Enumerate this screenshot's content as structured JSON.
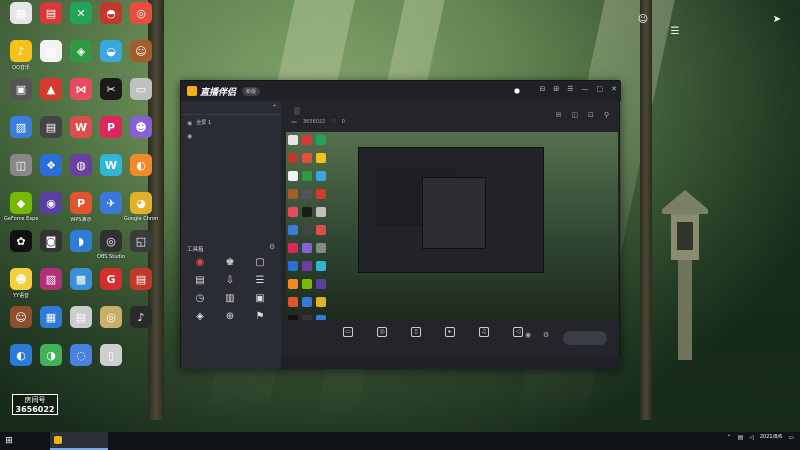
{
  "desktop": {
    "icons": [
      {
        "label": "",
        "color": "#e6e6e6",
        "glyph": "▦"
      },
      {
        "label": "",
        "color": "#d9383a",
        "glyph": "▤"
      },
      {
        "label": "",
        "color": "#22a35a",
        "glyph": "✕"
      },
      {
        "label": "",
        "color": "#c0392b",
        "glyph": "◓"
      },
      {
        "label": "",
        "color": "#e74c3c",
        "glyph": "◎"
      },
      {
        "label": "QQ音乐",
        "color": "#f4c21b",
        "glyph": "♪"
      },
      {
        "label": "",
        "color": "#f3f3f3",
        "glyph": "▥"
      },
      {
        "label": "",
        "color": "#2e9b44",
        "glyph": "◈"
      },
      {
        "label": "",
        "color": "#3aa7e0",
        "glyph": "◒"
      },
      {
        "label": "",
        "color": "#a35d2b",
        "glyph": "☺"
      },
      {
        "label": "",
        "color": "#555",
        "glyph": "▣"
      },
      {
        "label": "",
        "color": "#d63a2f",
        "glyph": "▲"
      },
      {
        "label": "",
        "color": "#e84a5f",
        "glyph": "⋈"
      },
      {
        "label": "",
        "color": "#1b1b1b",
        "glyph": "✂"
      },
      {
        "label": "",
        "color": "#c0c0c0",
        "glyph": "▭"
      },
      {
        "label": "",
        "color": "#3b7dd8",
        "glyph": "▨"
      },
      {
        "label": "",
        "color": "#444",
        "glyph": "▤"
      },
      {
        "label": "",
        "color": "#e04b4b",
        "glyph": "W"
      },
      {
        "label": "",
        "color": "#e0245e",
        "glyph": "P"
      },
      {
        "label": "",
        "color": "#8a5fd6",
        "glyph": "☻"
      },
      {
        "label": "",
        "color": "#888",
        "glyph": "◫"
      },
      {
        "label": "",
        "color": "#2b6fd6",
        "glyph": "❖"
      },
      {
        "label": "",
        "color": "#6b3fa0",
        "glyph": "◍"
      },
      {
        "label": "",
        "color": "#2fb7d8",
        "glyph": "W"
      },
      {
        "label": "",
        "color": "#f08a24",
        "glyph": "◐"
      },
      {
        "label": "GeForce Experience",
        "color": "#77b900",
        "glyph": "◆"
      },
      {
        "label": "",
        "color": "#5a3fa3",
        "glyph": "◉"
      },
      {
        "label": "WPS演示",
        "color": "#e0542f",
        "glyph": "P"
      },
      {
        "label": "",
        "color": "#3778d8",
        "glyph": "✈"
      },
      {
        "label": "Google Chrome",
        "color": "#e1b12c",
        "glyph": "◕"
      },
      {
        "label": "",
        "color": "#111",
        "glyph": "✿"
      },
      {
        "label": "",
        "color": "#333",
        "glyph": "◙"
      },
      {
        "label": "",
        "color": "#2f7bd8",
        "glyph": "◗"
      },
      {
        "label": "OBS Studio",
        "color": "#303030",
        "glyph": "◎"
      },
      {
        "label": "",
        "color": "#3b3b3b",
        "glyph": "◱"
      },
      {
        "label": "YY语音",
        "color": "#f4d03f",
        "glyph": "☻"
      },
      {
        "label": "",
        "color": "#b22f7a",
        "glyph": "▧"
      },
      {
        "label": "",
        "color": "#3a8fd6",
        "glyph": "▩"
      },
      {
        "label": "",
        "color": "#d62e2e",
        "glyph": "G"
      },
      {
        "label": "",
        "color": "#c0392b",
        "glyph": "▤"
      },
      {
        "label": "",
        "color": "#8e4f2e",
        "glyph": "☺"
      },
      {
        "label": "",
        "color": "#2f7bd8",
        "glyph": "▦"
      },
      {
        "label": "",
        "color": "#ccc",
        "glyph": "▤"
      },
      {
        "label": "",
        "color": "#c8b06a",
        "glyph": "◎"
      },
      {
        "label": "",
        "color": "#2a2a2a",
        "glyph": "♪"
      },
      {
        "label": "",
        "color": "#2b7bd8",
        "glyph": "◐"
      },
      {
        "label": "",
        "color": "#3fb25a",
        "glyph": "◑"
      },
      {
        "label": "",
        "color": "#4a80e0",
        "glyph": "◌"
      },
      {
        "label": "",
        "color": "#cfcfcf",
        "glyph": "▯"
      }
    ],
    "room_badge": {
      "line1": "房间号",
      "line2": "3656022"
    },
    "notes": [
      "",
      "",
      ""
    ]
  },
  "app": {
    "brand": "直播伴侣",
    "version_badge": "新版",
    "title_bar_icons": [
      "⊟",
      "⊞",
      "☰",
      "—",
      "▢",
      "✕"
    ],
    "left_tabs": [
      {
        "label": "",
        "active": true
      },
      {
        "label": "",
        "active": false
      },
      {
        "label": "",
        "active": false
      }
    ],
    "scene_items": [
      {
        "label": "全屏 1",
        "sub": false
      },
      {
        "label": "",
        "sub": true
      },
      {
        "label": "",
        "sub": true
      },
      {
        "label": "",
        "sub": false
      },
      {
        "label": "",
        "sub": true
      }
    ],
    "toolbox_title": "工具箱",
    "tools": [
      {
        "label": "",
        "glyph": "◉",
        "hot": true
      },
      {
        "label": "",
        "glyph": "♚",
        "hot": false
      },
      {
        "label": "",
        "glyph": "▢",
        "hot": false
      },
      {
        "label": "",
        "glyph": "▤",
        "hot": false
      },
      {
        "label": "",
        "glyph": "⇩",
        "hot": false
      },
      {
        "label": "",
        "glyph": "☰",
        "hot": false
      },
      {
        "label": "",
        "glyph": "◷",
        "hot": false
      },
      {
        "label": "",
        "glyph": "▥",
        "hot": false
      },
      {
        "label": "",
        "glyph": "▣",
        "hot": false
      },
      {
        "label": "",
        "glyph": "◈",
        "hot": false
      },
      {
        "label": "",
        "glyph": "⊕",
        "hot": false
      },
      {
        "label": "",
        "glyph": "⚑",
        "hot": false
      }
    ],
    "left_footer": "",
    "room_title": "",
    "room_tag": "",
    "room_id_label": "",
    "room_id": "3656022",
    "likes": "0",
    "controls": [
      {
        "label": "",
        "glyph": "▭"
      },
      {
        "label": "",
        "glyph": "◎"
      },
      {
        "label": "",
        "glyph": "▯"
      },
      {
        "label": "",
        "glyph": "▸"
      },
      {
        "label": "",
        "glyph": "♫"
      },
      {
        "label": "",
        "glyph": "◁"
      }
    ],
    "start_button": "",
    "status": [
      "",
      "",
      "",
      "",
      ""
    ]
  },
  "taskbar": {
    "app_label": "",
    "time": "",
    "date": "2021/8/6"
  }
}
